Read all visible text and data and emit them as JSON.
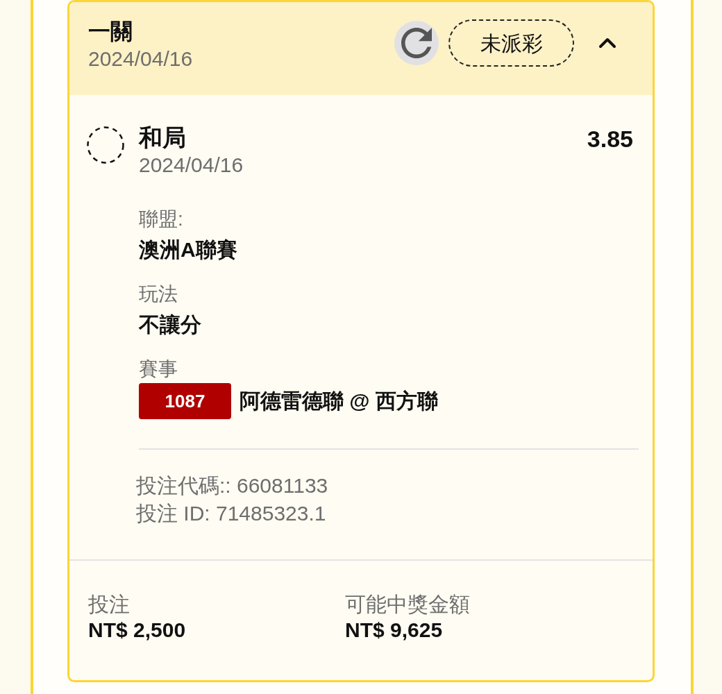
{
  "bet_card": {
    "title": "一關",
    "date": "2024/04/16",
    "status": "未派彩",
    "expanded": true,
    "selection": {
      "name": "和局",
      "date": "2024/04/16",
      "odds": "3.85"
    },
    "details": [
      {
        "kind": "text",
        "label": "聯盟:",
        "value": "澳洲A聯賽"
      },
      {
        "kind": "text",
        "label": "玩法",
        "value": "不讓分"
      },
      {
        "kind": "match",
        "label": "賽事",
        "match_number": "1087",
        "value": "阿德雷德聯 @ 西方聯"
      }
    ],
    "references": [
      "投注代碼:: 66081133",
      "投注 ID: 71485323.1"
    ],
    "summary": [
      {
        "label": "投注",
        "value": "NT$ 2,500"
      },
      {
        "label": "可能中獎金額",
        "value": "NT$ 9,625"
      }
    ]
  }
}
